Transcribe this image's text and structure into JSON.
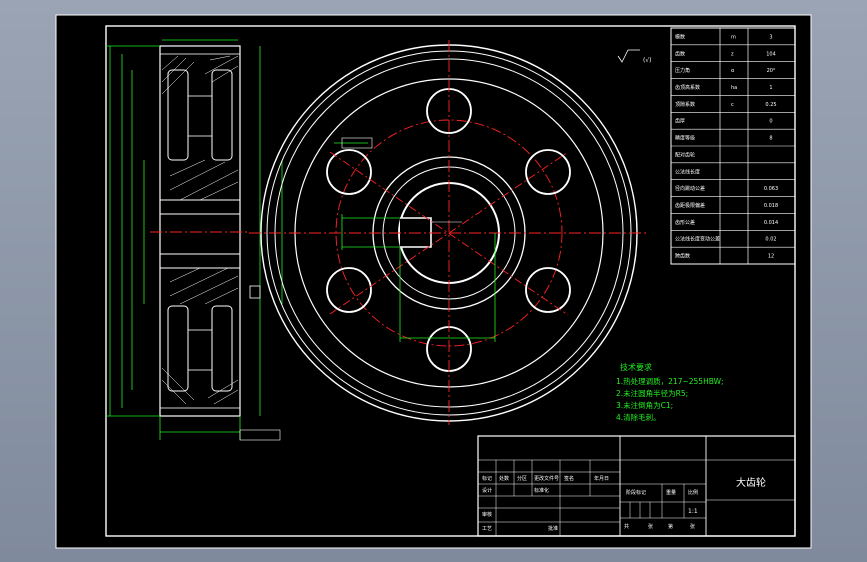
{
  "drawing": {
    "title": "大齿轮",
    "scale": "1:1",
    "view_label": "(√)"
  },
  "tech_requirements": {
    "heading": "技术要求",
    "items": [
      "1.热处理调质，217~255HBW;",
      "2.未注圆角半径为R5;",
      "3.未注倒角为C1;",
      "4.清除毛刺。"
    ]
  },
  "params": [
    {
      "label": "模数",
      "sym": "m",
      "val": "3"
    },
    {
      "label": "齿数",
      "sym": "z",
      "val": "104"
    },
    {
      "label": "压力角",
      "sym": "α",
      "val": "20°"
    },
    {
      "label": "齿顶高系数",
      "sym": "ha",
      "val": "1"
    },
    {
      "label": "顶隙系数",
      "sym": "c",
      "val": "0.25"
    },
    {
      "label": "齿厚",
      "sym": "",
      "val": "0"
    },
    {
      "label": "精度等级",
      "sym": "",
      "val": "8"
    },
    {
      "label": "配对齿轮",
      "sym": "",
      "val": ""
    },
    {
      "label": "公法线长度",
      "sym": "",
      "val": ""
    },
    {
      "label": "径向跳动公差",
      "sym": "",
      "val": "0.063"
    },
    {
      "label": "齿距极限偏差",
      "sym": "",
      "val": "0.018"
    },
    {
      "label": "齿形公差",
      "sym": "",
      "val": "0.014"
    },
    {
      "label": "公法线长度变动公差",
      "sym": "",
      "val": "0.02"
    },
    {
      "label": "跨齿数",
      "sym": "",
      "val": "12"
    }
  ],
  "title_block": {
    "labels": [
      "标记",
      "处数",
      "分区",
      "更改文件号",
      "签名",
      "年月日",
      "设计",
      "标准化",
      "阶段标记",
      "重量",
      "比例",
      "审核",
      "工艺",
      "批准"
    ],
    "stage_marks": [
      "共",
      "张",
      "第",
      "张"
    ]
  },
  "colors": {
    "frame": "#ffffff",
    "dimension": "#22ee22",
    "centerline": "#ff2222",
    "background": "#000000"
  }
}
